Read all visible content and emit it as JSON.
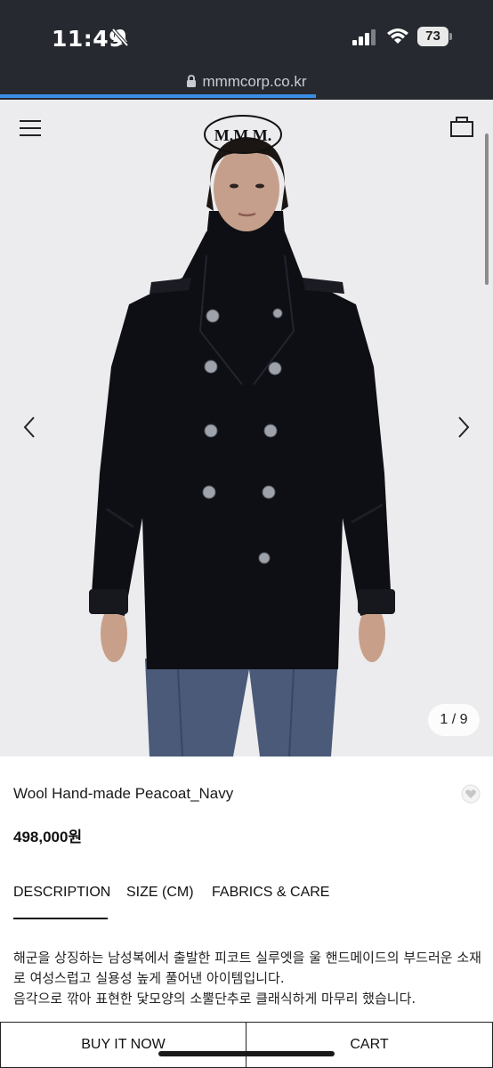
{
  "status_bar": {
    "time": "11:49",
    "battery": "73",
    "icons": [
      "bell-off-icon",
      "signal-icon",
      "wifi-icon",
      "battery-icon"
    ]
  },
  "browser": {
    "url": "mmmcorp.co.kr",
    "load_progress": 0.64
  },
  "header": {
    "logo_text": "M.M.M.",
    "icons": [
      "hamburger-menu-icon",
      "shopping-bag-icon"
    ]
  },
  "gallery": {
    "counter": "1 / 9",
    "current": 1,
    "total": 9,
    "icons": [
      "arrow-left-icon",
      "arrow-right-icon"
    ]
  },
  "product": {
    "name": "Wool Hand-made Peacoat_Navy",
    "price": "498,000원",
    "wishlist_icon": "heart-icon"
  },
  "tabs": [
    {
      "label": "DESCRIPTION",
      "active": true
    },
    {
      "label": "SIZE (CM)",
      "active": false
    },
    {
      "label": "FABRICS & CARE",
      "active": false
    }
  ],
  "description": {
    "line1": "해군을 상징하는 남성복에서 출발한 피코트 실루엣을 울 핸드메이드의 부드러운 소재로 여성스럽고 실용성 높게 풀어낸 아이템입니다.",
    "line2": "음각으로 깎아 표현한 닻모양의 소뿔단추로 클래식하게 마무리 했습니다."
  },
  "actions": {
    "buy_label": "BUY IT NOW",
    "cart_label": "CART"
  },
  "colors": {
    "status_bg": "#262a30",
    "accent": "#3b8ee6",
    "coat": "#0e0f14"
  }
}
